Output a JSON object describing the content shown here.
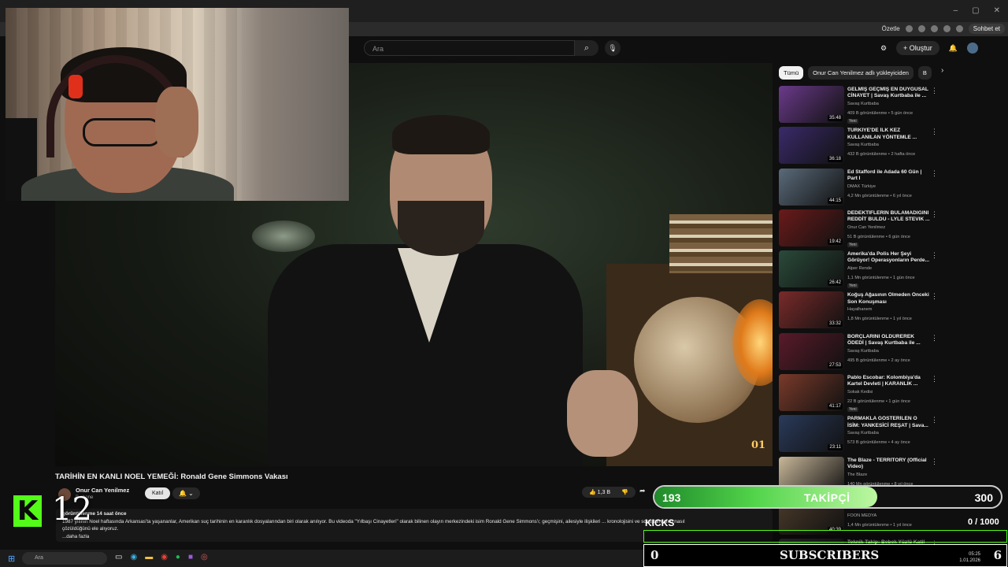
{
  "browser": {
    "window_buttons": [
      "–",
      "▢",
      "✕"
    ],
    "toolbar_label": "Özetle",
    "chat_button": "Sohbet et"
  },
  "youtube": {
    "search_placeholder": "Ara",
    "create_label": "+ Oluştur"
  },
  "video": {
    "title": "TARİHİN EN KANLI NOEL YEMEĞİ: Ronald Gene Simmons Vakası",
    "overlay_logo": "01",
    "channel_name": "Onur Can Yenilmez",
    "subscribers": "B abone",
    "join_label": "Katıl",
    "likes": "1,3 B",
    "description_meta": "görüntülenme  14 saat önce",
    "description_text": "1987 yılının Noel haftasında Arkansas'ta yaşananlar, Amerikan suç tarihinin en karanlık dosyalarından biri olarak anılıyor. Bu videoda \"Yılbaşı Cinayetleri\" olarak bilinen olayın merkezindeki isim Ronald Gene Simmons'ı; geçmişini, ailesiyle ilişkileri ... kronolojisini ve soruşturmanın nasıl",
    "description_text2": "çözüldüğünü ele alıyoruz.",
    "more_label": "...daha fazla"
  },
  "chips": [
    "Tümü",
    "Onur Can Yenilmez adlı yükleyiciden",
    "B"
  ],
  "recommendations": [
    {
      "title": "GELMİŞ GEÇMİŞ EN DUYGUSAL CİNAYET | Savaş Kurtbaba ile ...",
      "channel": "Savaş Kurtbaba",
      "meta": "409 B görüntülenme • 5 gün önce",
      "badge": "Yeni",
      "duration": "35:48",
      "color": "#6a3a8a"
    },
    {
      "title": "TÜRKİYE'DE İLK KEZ KULLANILAN YÖNTEMLE ...",
      "channel": "Savaş Kurtbaba",
      "meta": "432 B görüntülenme • 2 hafta önce",
      "badge": "",
      "duration": "36:18",
      "color": "#3a2a6a"
    },
    {
      "title": "Ed Stafford ile Adada 60 Gün | Part I",
      "channel": "DMAX Türkiye",
      "meta": "4,2 Mn görüntülenme • 6 yıl önce",
      "badge": "",
      "duration": "44:15",
      "color": "#5a6a7a"
    },
    {
      "title": "DEDEKTİFLERİN BULAMADIĞINI REDDİT BULDU - LYLE STEVIK ...",
      "channel": "Onur Can Yenilmez",
      "meta": "51 B görüntülenme • 6 gün önce",
      "badge": "Yeni",
      "duration": "19:42",
      "color": "#6a1a1a"
    },
    {
      "title": "Amerika'da Polis Her Şeyi Görüyor! Operasyonların Perde...",
      "channel": "Alper Rende",
      "meta": "1,1 Mn görüntülenme • 1 gün önce",
      "badge": "Yeni",
      "duration": "26:42",
      "color": "#2a4a3a"
    },
    {
      "title": "Koğuş Ağasının Ölmeden Önceki Son Konuşması",
      "channel": "Hayalhanem",
      "meta": "1,8 Mn görüntülenme • 1 yıl önce",
      "badge": "",
      "duration": "33:32",
      "color": "#7a2a2a"
    },
    {
      "title": "BORÇLARINI ÖLDÜREREK ÖDEDİ | Savaş Kurtbaba ile ...",
      "channel": "Savaş Kurtbaba",
      "meta": "495 B görüntülenme • 2 ay önce",
      "badge": "",
      "duration": "27:53",
      "color": "#5a1a2a"
    },
    {
      "title": "Pablo Escobar: Kolombiya'da Kartel Devleti | KARANLIK ...",
      "channel": "Sokak Kedisi",
      "meta": "22 B görüntülenme • 1 gün önce",
      "badge": "Yeni",
      "duration": "41:17",
      "color": "#7a3a2a"
    },
    {
      "title": "PARMAKLA GÖSTERİLEN O İSİM: YANKESİCİ REŞAT | Sava...",
      "channel": "Savaş Kurtbaba",
      "meta": "573 B görüntülenme • 4 ay önce",
      "badge": "",
      "duration": "23:11",
      "color": "#2a3a5a"
    },
    {
      "title": "The Blaze - TERRITORY (Official Video)",
      "channel": "The Blaze",
      "meta": "140 Mn görüntülenme • 8 yıl önce",
      "badge": "",
      "duration": "",
      "color": "#c9b89a"
    },
    {
      "title": "... Kolici Orhan | Savaş Kurtba...",
      "channel": "FOON MEDYA",
      "meta": "1,4 Mn görüntülenme • 1 yıl önce",
      "badge": "",
      "duration": "40:39",
      "color": "#4a3a2a"
    },
    {
      "title": "Teknik Takip: Bebek Yüzlü Katil",
      "channel": "",
      "meta": "",
      "badge": "",
      "duration": "",
      "color": "#3a3a3a"
    }
  ],
  "stream": {
    "kick_logo": "K",
    "viewer_count": "12",
    "follower_goal": {
      "current": "193",
      "label": "TAKİPÇİ",
      "target": "300",
      "progress": 0.643
    },
    "kicks": {
      "label": "KICKS",
      "value": "0  / 1000"
    },
    "subscribers": {
      "current": "0",
      "label": "SUBSCRIBERS",
      "target": "6"
    }
  },
  "taskbar": {
    "search_placeholder": "Ara",
    "time": "05:25",
    "date": "1.01.2026"
  }
}
